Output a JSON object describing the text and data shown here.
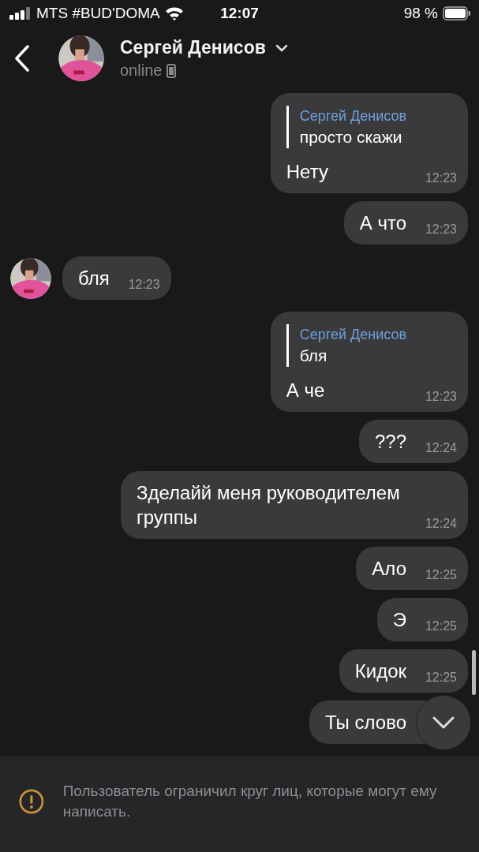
{
  "status_bar": {
    "carrier": "MTS #BUD'DOMA",
    "time": "12:07",
    "battery": "98 %"
  },
  "header": {
    "name": "Сергей Денисов",
    "status": "online"
  },
  "messages": [
    {
      "kind": "out",
      "reply": {
        "author": "Сергей Денисов",
        "text": "просто скажи"
      },
      "text": "Нету",
      "time": "12:23"
    },
    {
      "kind": "out",
      "text": "А что",
      "time": "12:23"
    },
    {
      "kind": "in",
      "text": "бля",
      "time": "12:23"
    },
    {
      "kind": "out",
      "reply": {
        "author": "Сергей Денисов",
        "text": "бля"
      },
      "text": "А че",
      "time": "12:23"
    },
    {
      "kind": "out",
      "text": "???",
      "time": "12:24"
    },
    {
      "kind": "out",
      "text": "Зделайй меня руководителем группы",
      "time": "12:24"
    },
    {
      "kind": "out",
      "text": "Ало",
      "time": "12:25"
    },
    {
      "kind": "out",
      "text": "Э",
      "time": "12:25"
    },
    {
      "kind": "out",
      "text": "Кидок",
      "time": "12:25"
    },
    {
      "kind": "out",
      "text": "Ты слово"
    }
  ],
  "notice": "Пользователь ограничил круг лиц, которые могут ему написать."
}
